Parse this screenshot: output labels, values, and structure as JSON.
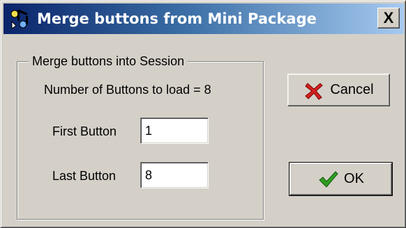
{
  "window": {
    "title": "Merge buttons from Mini Package",
    "close_label": "X",
    "app_icon": "music-note-icon"
  },
  "group": {
    "legend": "Merge buttons into Session",
    "count_label": "Number of Buttons to load = 8",
    "first_label": "First Button",
    "first_value": "1",
    "last_label": "Last Button",
    "last_value": "8"
  },
  "buttons": {
    "cancel_label": "Cancel",
    "cancel_icon": "red-x-icon",
    "ok_label": "OK",
    "ok_icon": "green-check-icon"
  },
  "colors": {
    "title_gradient_start": "#0a246a",
    "title_gradient_end": "#a6caf0",
    "cancel_icon": "#d42020",
    "ok_icon": "#2e9e1f"
  }
}
